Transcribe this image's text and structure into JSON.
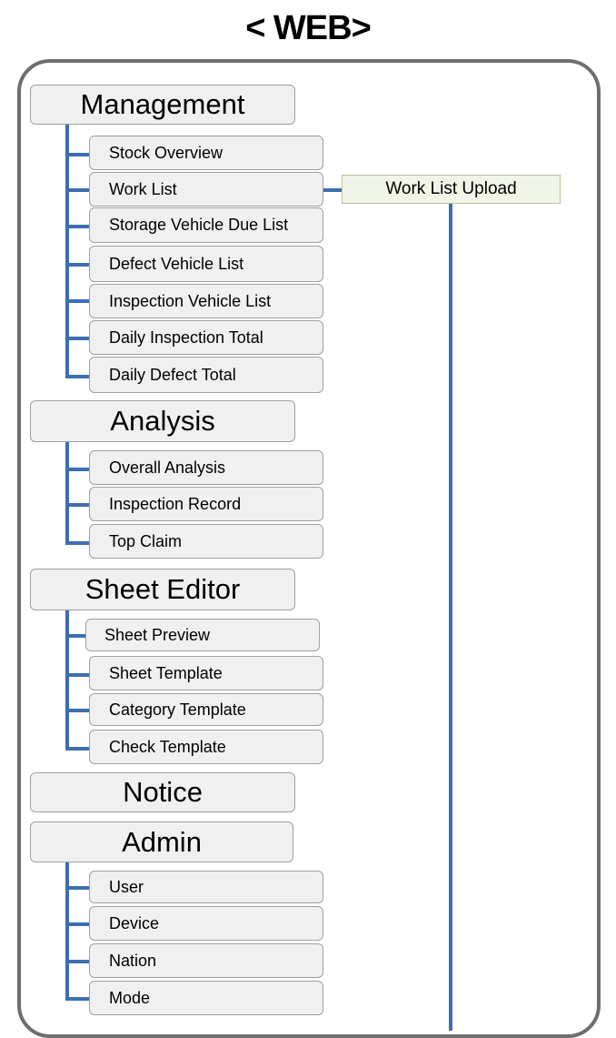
{
  "title": "< WEB>",
  "groups": [
    {
      "label": "Management",
      "items": [
        "Stock Overview",
        "Work List",
        "Storage Vehicle Due List",
        "Defect Vehicle List",
        "Inspection Vehicle List",
        "Daily Inspection Total",
        "Daily Defect Total"
      ]
    },
    {
      "label": "Analysis",
      "items": [
        "Overall Analysis",
        "Inspection Record",
        "Top Claim"
      ]
    },
    {
      "label": "Sheet Editor",
      "items": [
        "Sheet Preview",
        "Sheet Template",
        "Category Template",
        "Check Template"
      ]
    },
    {
      "label": "Notice",
      "items": []
    },
    {
      "label": "Admin",
      "items": [
        "User",
        "Device",
        "Nation",
        "Mode"
      ]
    }
  ],
  "side_box": "Work List Upload",
  "colors": {
    "connector": "#3e6eb0",
    "box_fill": "#f0f0f0",
    "side_box_fill": "#f1f5e8",
    "frame": "#6e6e6e"
  }
}
